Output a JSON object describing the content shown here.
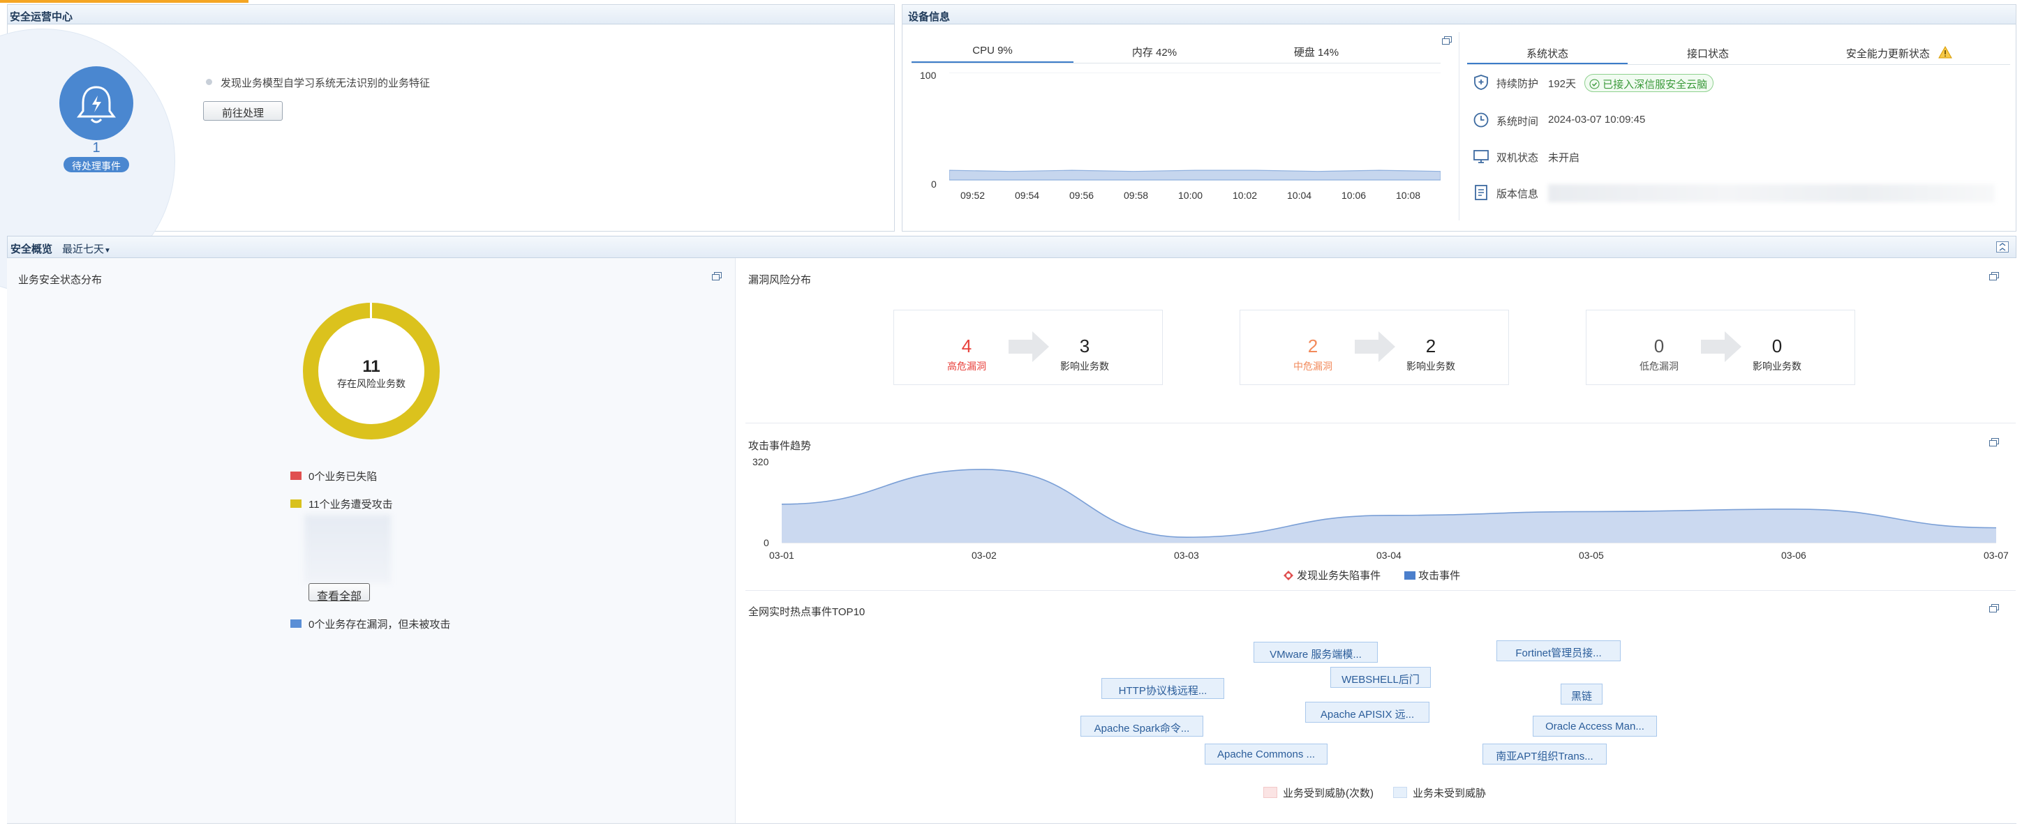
{
  "top_tab": {
    "color": "#f5a623"
  },
  "ops_center": {
    "title": "安全运营中心",
    "pending_count": "1",
    "pending_label": "待处理事件",
    "message": "发现业务模型自学习系统无法识别的业务特征",
    "action_button": "前往处理"
  },
  "device_info": {
    "title": "设备信息",
    "tabs": [
      "CPU 9%",
      "内存 42%",
      "硬盘 14%"
    ],
    "cpu_chart": {
      "type": "area",
      "x": [
        "09:52",
        "09:54",
        "09:56",
        "09:58",
        "10:00",
        "10:02",
        "10:04",
        "10:06",
        "10:08"
      ],
      "values": [
        9,
        8,
        9,
        8,
        9,
        9,
        8,
        9,
        8
      ],
      "ylim": [
        0,
        100
      ],
      "yticks": [
        "100",
        "0"
      ]
    },
    "status_tabs": [
      "系统状态",
      "接口状态",
      "安全能力更新状态"
    ],
    "rows": [
      {
        "icon": "shield-icon",
        "label": "持续防护",
        "value": "192天",
        "badge": "已接入深信服安全云脑"
      },
      {
        "icon": "clock-icon",
        "label": "系统时间",
        "value": "2024-03-07 10:09:45"
      },
      {
        "icon": "monitor-icon",
        "label": "双机状态",
        "value": "未开启"
      },
      {
        "icon": "document-icon",
        "label": "版本信息",
        "value": ""
      }
    ]
  },
  "overview": {
    "title": "安全概览",
    "range": "最近七天"
  },
  "business_status": {
    "title": "业务安全状态分布",
    "donut_value": "11",
    "donut_label": "存在风险业务数",
    "legend": [
      {
        "label": "0个业务已失陷",
        "color": "#e05050"
      },
      {
        "label": "11个业务遭受攻击",
        "color": "#d9c11c"
      },
      {
        "label": "0个业务存在漏洞，但未被攻击",
        "color": "#5b8fd6"
      }
    ],
    "view_all": "查看全部"
  },
  "vuln": {
    "title": "漏洞风险分布",
    "cards": [
      {
        "count": "4",
        "label": "高危漏洞",
        "color": "#e8413c",
        "affected": "3",
        "affected_label": "影响业务数"
      },
      {
        "count": "2",
        "label": "中危漏洞",
        "color": "#f28a5b",
        "affected": "2",
        "affected_label": "影响业务数"
      },
      {
        "count": "0",
        "label": "低危漏洞",
        "color": "#555555",
        "affected": "0",
        "affected_label": "影响业务数"
      }
    ]
  },
  "attack_trend": {
    "title": "攻击事件趋势",
    "legend": [
      "发现业务失陷事件",
      "攻击事件"
    ],
    "chart_data": {
      "type": "area",
      "x": [
        "03-01",
        "03-02",
        "03-03",
        "03-04",
        "03-05",
        "03-06",
        "03-07"
      ],
      "series": [
        {
          "name": "攻击事件",
          "values": [
            155,
            295,
            22,
            110,
            125,
            135,
            60
          ]
        },
        {
          "name": "发现业务失陷事件",
          "values": [
            0,
            0,
            0,
            0,
            0,
            0,
            0
          ]
        }
      ],
      "ylim": [
        0,
        320
      ],
      "yticks": [
        "320",
        "0"
      ]
    }
  },
  "hot_events": {
    "title": "全网实时热点事件TOP10",
    "tags": [
      "VMware 服务端模...",
      "Fortinet管理员接...",
      "WEBSHELL后门",
      "HTTP协议栈远程...",
      "黑链",
      "Apache APISIX 远...",
      "Apache Spark命令...",
      "Oracle Access Man...",
      "Apache Commons ...",
      "南亚APT组织Trans..."
    ],
    "legend": [
      "业务受到威胁(次数)",
      "业务未受到威胁"
    ]
  }
}
